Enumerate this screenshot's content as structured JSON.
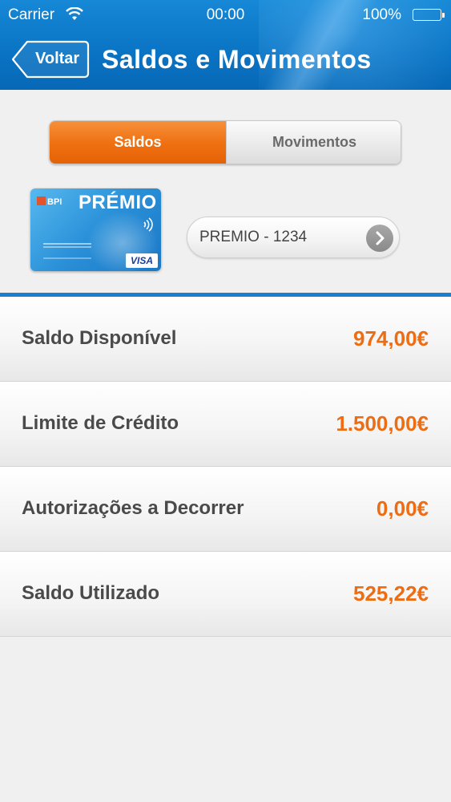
{
  "status_bar": {
    "carrier": "Carrier",
    "time": "00:00",
    "battery": "100%"
  },
  "header": {
    "back_label": "Voltar",
    "title": "Saldos e Movimentos"
  },
  "segmented": {
    "options": [
      "Saldos",
      "Movimentos"
    ],
    "selected": "Saldos"
  },
  "card": {
    "bank": "BPI",
    "name": "PRÉMIO",
    "network": "VISA"
  },
  "account_selector": {
    "value": "PREMIO - 1234",
    "icon": "chevron-right-icon"
  },
  "balances": [
    {
      "label": "Saldo Disponível",
      "value": "974,00€"
    },
    {
      "label": "Limite de Crédito",
      "value": "1.500,00€"
    },
    {
      "label": "Autorizações a Decorrer",
      "value": "0,00€"
    },
    {
      "label": "Saldo Utilizado",
      "value": "525,22€"
    }
  ],
  "colors": {
    "header_blue": "#0a73c4",
    "accent_orange": "#ee6c12",
    "divider_blue": "#1a7fcf"
  }
}
